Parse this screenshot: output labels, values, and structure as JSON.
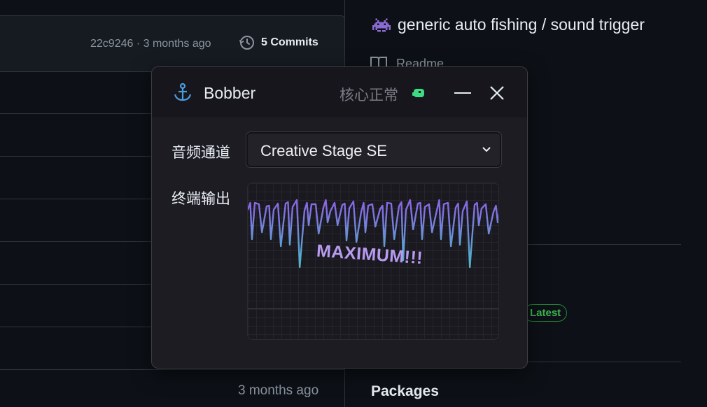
{
  "background": {
    "commit_meta": "22c9246 · 3 months ago",
    "commits_label": "5 Commits",
    "bottom_time": "3 months ago",
    "repo_title": "generic auto fishing / sound trigger",
    "readme_label": "Readme",
    "latest_badge": "Latest",
    "packages_label": "Packages"
  },
  "window": {
    "title": "Bobber",
    "status": "核心正常",
    "audio_channel_label": "音频通道",
    "audio_channel_value": "Creative Stage SE",
    "terminal_label": "终端输出",
    "terminal_overlay": "MAXIMUM!!!"
  },
  "colors": {
    "accent_green": "#3ddc84",
    "badge_green": "#3fb950",
    "wave_top": "#8b63e6",
    "wave_bottom": "#4db6c8"
  },
  "icons": {
    "app": "anchor-icon",
    "status": "robot-icon",
    "repo": "space-invader-icon",
    "commits": "history-icon",
    "readme": "book-icon"
  }
}
